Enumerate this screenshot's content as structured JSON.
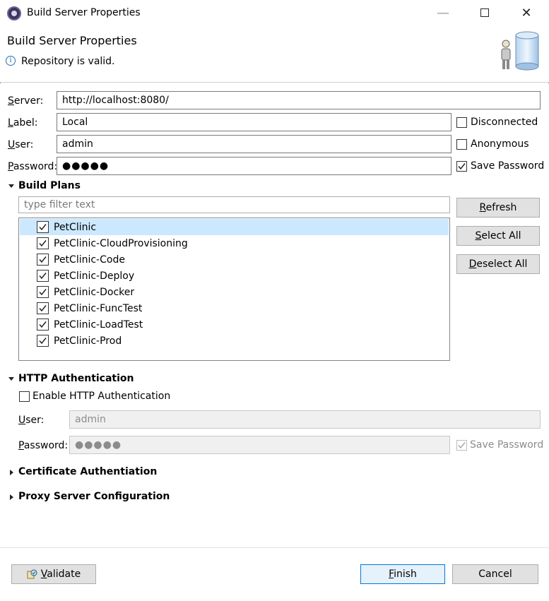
{
  "window": {
    "title": "Build Server Properties"
  },
  "banner": {
    "title": "Build Server Properties",
    "message": "Repository is valid."
  },
  "form": {
    "server_label": "Server:",
    "server_value": "http://localhost:8080/",
    "label_label": "Label:",
    "label_value": "Local",
    "user_label": "User:",
    "user_value": "admin",
    "password_label": "Password:",
    "password_value": "●●●●●",
    "disconnected_label": "Disconnected",
    "disconnected_checked": false,
    "anonymous_label": "Anonymous",
    "anonymous_checked": false,
    "save_password_label": "Save Password",
    "save_password_checked": true
  },
  "build_plans": {
    "section_title": "Build Plans",
    "filter_placeholder": "type filter text",
    "buttons": {
      "refresh": "Refresh",
      "select_all": "Select All",
      "deselect_all": "Deselect All"
    },
    "items": [
      {
        "label": "PetClinic",
        "checked": true,
        "selected": true
      },
      {
        "label": "PetClinic-CloudProvisioning",
        "checked": true,
        "selected": false
      },
      {
        "label": "PetClinic-Code",
        "checked": true,
        "selected": false
      },
      {
        "label": "PetClinic-Deploy",
        "checked": true,
        "selected": false
      },
      {
        "label": "PetClinic-Docker",
        "checked": true,
        "selected": false
      },
      {
        "label": "PetClinic-FuncTest",
        "checked": true,
        "selected": false
      },
      {
        "label": "PetClinic-LoadTest",
        "checked": true,
        "selected": false
      },
      {
        "label": "PetClinic-Prod",
        "checked": true,
        "selected": false
      }
    ]
  },
  "http_auth": {
    "section_title": "HTTP Authentication",
    "enable_label": "Enable HTTP Authentication",
    "enable_checked": false,
    "user_label": "User:",
    "user_value": "admin",
    "password_label": "Password:",
    "password_value": "●●●●●",
    "save_password_label": "Save Password",
    "save_password_checked": true
  },
  "collapsed_sections": {
    "certificate": "Certificate Authentiation",
    "proxy": "Proxy Server Configuration"
  },
  "footer": {
    "validate": "Validate",
    "finish": "Finish",
    "cancel": "Cancel"
  },
  "colors": {
    "accent": "#0078d7",
    "selection": "#cce8ff",
    "info": "#2a6fb5"
  }
}
